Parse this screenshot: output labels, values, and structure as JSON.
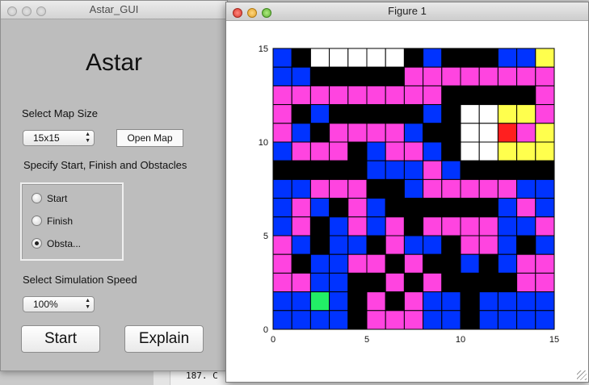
{
  "astar_window": {
    "title": "Astar_GUI",
    "heading": "Astar",
    "map_size_label": "Select Map Size",
    "map_size_value": "15x15",
    "open_map_label": "Open Map",
    "specify_label": "Specify Start, Finish and Obstacles",
    "radio_options": [
      {
        "label": "Start",
        "selected": false
      },
      {
        "label": "Finish",
        "selected": false
      },
      {
        "label": "Obsta...",
        "selected": true
      }
    ],
    "speed_label": "Select Simulation Speed",
    "speed_value": "100%",
    "start_button": "Start",
    "explain_button": "Explain"
  },
  "figure_window": {
    "title": "Figure 1"
  },
  "editor_line": "187. C",
  "colors": {
    "K": "#000000",
    "B": "#0033ff",
    "M": "#ff44e0",
    "W": "#ffffff",
    "Y": "#ffff4d",
    "R": "#ff1f1f",
    "G": "#22ee66"
  },
  "chart_data": {
    "type": "heatmap",
    "x_ticks": [
      0,
      5,
      10,
      15
    ],
    "y_ticks": [
      0,
      5,
      10,
      15
    ],
    "xlim": [
      0,
      15
    ],
    "ylim": [
      0,
      15
    ],
    "rows_top_to_bottom": [
      "BKWWWWWKBKKKBBY",
      "BBKKKKKMMMMMMMM",
      "MMMMMMMMMKKKKKM",
      "MKBKKKKKBKWWYYM",
      "MBKMMMMBKKWWRMY",
      "BMMMKBMMBKWWYYY",
      "KKKKKBBBMBKKKKK",
      "BBMMMKKBMMMMMBB",
      "BMBKMBKKKKKKBMB",
      "BMKBMBMKMMMMBBM",
      "MBKBBKMBBKMMBKB",
      "MKBBMMKMKKBKBMM",
      "MMBBKKMKMKKKKMM",
      "BBGBKMKMBBKBBBB",
      "BBBBKMMMBBKBBBB"
    ]
  }
}
